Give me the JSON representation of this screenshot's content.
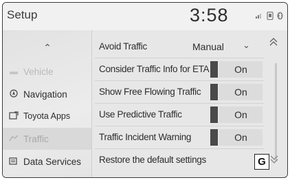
{
  "header": {
    "title": "Setup",
    "clock": "3:58",
    "status_icons": [
      "signal-icon",
      "phone-icon",
      "bluetooth-icon"
    ]
  },
  "sidebar": {
    "items": [
      {
        "label": "Vehicle",
        "icon": "car-icon",
        "state": "dim"
      },
      {
        "label": "Navigation",
        "icon": "navigation-icon",
        "state": "normal"
      },
      {
        "label": "Toyota Apps",
        "icon": "apps-icon",
        "state": "normal"
      },
      {
        "label": "Traffic",
        "icon": "traffic-icon",
        "state": "active"
      },
      {
        "label": "Data Services",
        "icon": "data-services-icon",
        "state": "normal"
      }
    ]
  },
  "main": {
    "avoid_traffic": {
      "label": "Avoid Traffic",
      "value": "Manual"
    },
    "toggles": [
      {
        "label": "Consider Traffic Info for ETA",
        "state": "On"
      },
      {
        "label": "Show Free Flowing Traffic",
        "state": "On"
      },
      {
        "label": "Use Predictive Traffic",
        "state": "On"
      },
      {
        "label": "Traffic Incident Warning",
        "state": "On"
      }
    ],
    "restore_label": "Restore the default settings"
  },
  "callout": "G"
}
